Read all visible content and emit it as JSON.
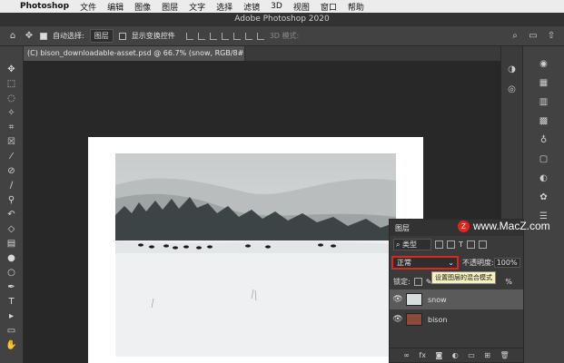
{
  "menubar": {
    "app": "Photoshop",
    "items": [
      "文件",
      "编辑",
      "图像",
      "图层",
      "文字",
      "选择",
      "滤镜",
      "3D",
      "视图",
      "窗口",
      "帮助"
    ]
  },
  "window": {
    "title": "Adobe Photoshop 2020"
  },
  "options": {
    "auto_select_label": "自动选择:",
    "auto_select_value": "图层",
    "show_transform_label": "显示变换控件",
    "mode_3d": "3D 模式:"
  },
  "document": {
    "tab_title": "(C) bison_downloadable-asset.psd @ 66.7% (snow, RGB/8#) *"
  },
  "layers_panel": {
    "tab": "图层",
    "kind_label": "类型",
    "blend_mode": "正常",
    "opacity_label": "不透明度:",
    "opacity_value": "100%",
    "fill_value": "%",
    "lock_label": "锁定:",
    "tooltip": "设置图层的混合模式",
    "layers": [
      {
        "name": "snow",
        "visible": true,
        "selected": true
      },
      {
        "name": "bison",
        "visible": true,
        "selected": false
      }
    ]
  },
  "watermark": {
    "text": "www.MacZ.com",
    "logo": "Z"
  },
  "colors": {
    "accent_red": "#e0261c",
    "panel": "#424242",
    "canvas": "#282828"
  }
}
